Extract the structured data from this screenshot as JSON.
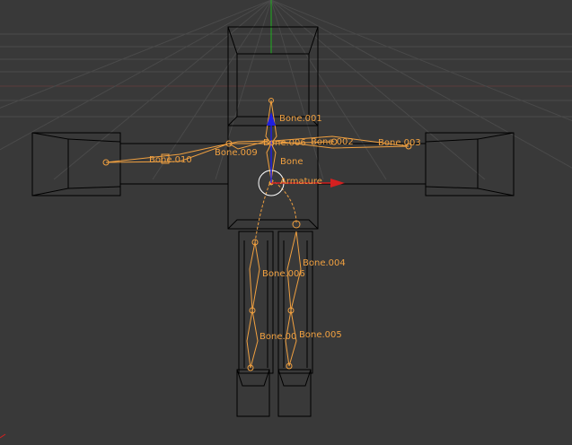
{
  "viewport": {
    "name": "3d-viewport",
    "background": "#393939",
    "grid_color": "#4a4a4a",
    "mesh_color": "#000000",
    "bone_color": "#f0a040",
    "axis_colors": {
      "x": "#d42020",
      "y": "#20b020",
      "z": "#2020e0"
    }
  },
  "bone_labels": [
    "Bone.001",
    "Bone.006",
    "Bone.002",
    "Bone.003",
    "Bone.010",
    "Bone.009",
    "Bone",
    "Armature",
    "Bone.004",
    "Bone.006",
    "Bone.00",
    "Bone.005"
  ]
}
